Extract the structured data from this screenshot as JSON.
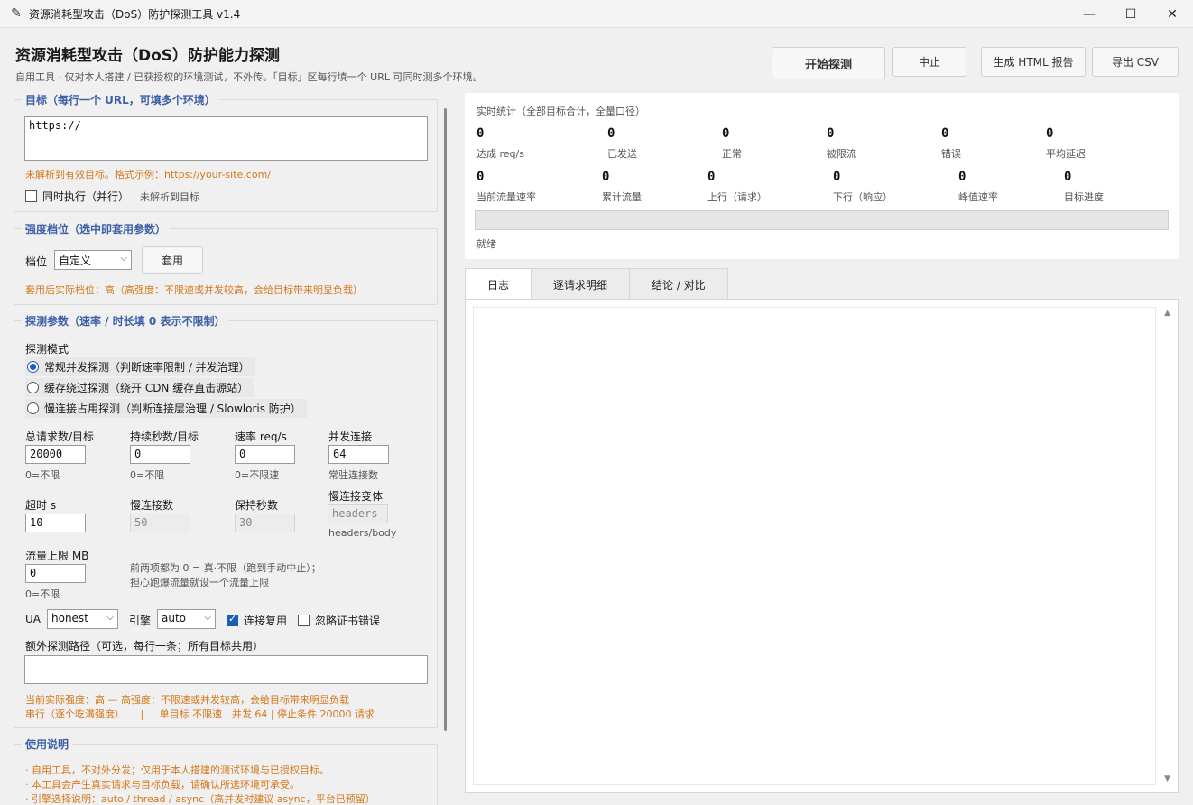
{
  "window": {
    "title": "资源消耗型攻击（DoS）防护探测工具  v1.4",
    "minimize": "—",
    "maximize": "☐",
    "close": "✕"
  },
  "header": {
    "title": "资源消耗型攻击（DoS）防护能力探测",
    "subtitle": "自用工具 · 仅对本人搭建 / 已获授权的环境测试，不外传。「目标」区每行填一个 URL 可同时测多个环境。",
    "buttons": {
      "start": "开始探测",
      "stop": "中止",
      "html_report": "生成 HTML 报告",
      "export_csv": "导出 CSV"
    }
  },
  "target": {
    "legend": "目标（每行一个 URL，可填多个环境）",
    "value": "https://",
    "hint": "未解析到有效目标。格式示例：https://your-site.com/",
    "parallel_label": "同时执行（并行）",
    "parallel_status": "未解析到目标"
  },
  "intensity": {
    "legend": "强度档位（选中即套用参数）",
    "level_label": "档位",
    "level_value": "自定义",
    "apply_button": "套用",
    "note": "套用后实际档位：高（高强度：不限速或并发较高，会给目标带来明显负载）"
  },
  "params": {
    "legend": "探测参数（速率 / 时长填 0 表示不限制）",
    "mode_label": "探测模式",
    "modes": [
      "常规并发探测（判断速率限制 / 并发治理）",
      "缓存绕过探测（绕开 CDN 缓存直击源站）",
      "慢连接占用探测（判断连接层治理 / Slowloris 防护）"
    ],
    "fields": {
      "total_requests": {
        "label": "总请求数/目标",
        "value": "20000",
        "hint": "0=不限"
      },
      "duration": {
        "label": "持续秒数/目标",
        "value": "0",
        "hint": "0=不限"
      },
      "rate": {
        "label": "速率 req/s",
        "value": "0",
        "hint": "0=不限速"
      },
      "concurrency": {
        "label": "并发连接",
        "value": "64",
        "hint": "常驻连接数"
      },
      "timeout": {
        "label": "超时 s",
        "value": "10"
      },
      "slow_conns": {
        "label": "慢连接数",
        "value": "50"
      },
      "hold_secs": {
        "label": "保持秒数",
        "value": "30"
      },
      "slow_variant": {
        "label": "慢连接变体",
        "value": "headers",
        "hint": "headers/body"
      },
      "traffic_cap": {
        "label": "流量上限 MB",
        "value": "0",
        "hint": "0=不限"
      }
    },
    "traffic_note_1": "前两项都为 0 = 真·不限（跑到手动中止）；",
    "traffic_note_2": "担心跑爆流量就设一个流量上限",
    "ua_label": "UA",
    "ua_value": "honest",
    "engine_label": "引擎",
    "engine_value": "auto",
    "reuse_label": "连接复用",
    "ignore_cert_label": "忽略证书错误",
    "extra_paths_label": "额外探测路径（可选，每行一条；所有目标共用）",
    "summary_1": "当前实际强度：高  —   高强度：不限速或并发较高，会给目标带来明显负载",
    "summary_2": "串行（逐个吃满强度）     |     单目标 不限速 | 并发 64 | 停止条件 20000 请求"
  },
  "usage": {
    "legend": "使用说明",
    "lines": [
      "· 自用工具，不对外分发；仅用于本人搭建的测试环境与已授权目标。",
      "· 本工具会产生真实请求与目标负载，请确认所选环境可承受。",
      "· 引擎选择说明：auto / thread / async（高并发时建议 async，平台已预留）"
    ]
  },
  "stats": {
    "caption": "实时统计（全部目标合计，全量口径）",
    "row1": [
      {
        "value": "0",
        "label": "达成 req/s"
      },
      {
        "value": "0",
        "label": "已发送"
      },
      {
        "value": "0",
        "label": "正常"
      },
      {
        "value": "0",
        "label": "被限流"
      },
      {
        "value": "0",
        "label": "错误"
      },
      {
        "value": "0",
        "label": "平均延迟"
      }
    ],
    "row2": [
      {
        "value": "0",
        "label": "当前流量速率"
      },
      {
        "value": "0",
        "label": "累计流量"
      },
      {
        "value": "0",
        "label": "上行（请求）"
      },
      {
        "value": "0",
        "label": "下行（响应）"
      },
      {
        "value": "0",
        "label": "峰值速率"
      },
      {
        "value": "0",
        "label": "目标进度"
      }
    ],
    "progress": 0,
    "status": "就绪"
  },
  "tabs": [
    "日志",
    "逐请求明细",
    "结论 / 对比"
  ]
}
